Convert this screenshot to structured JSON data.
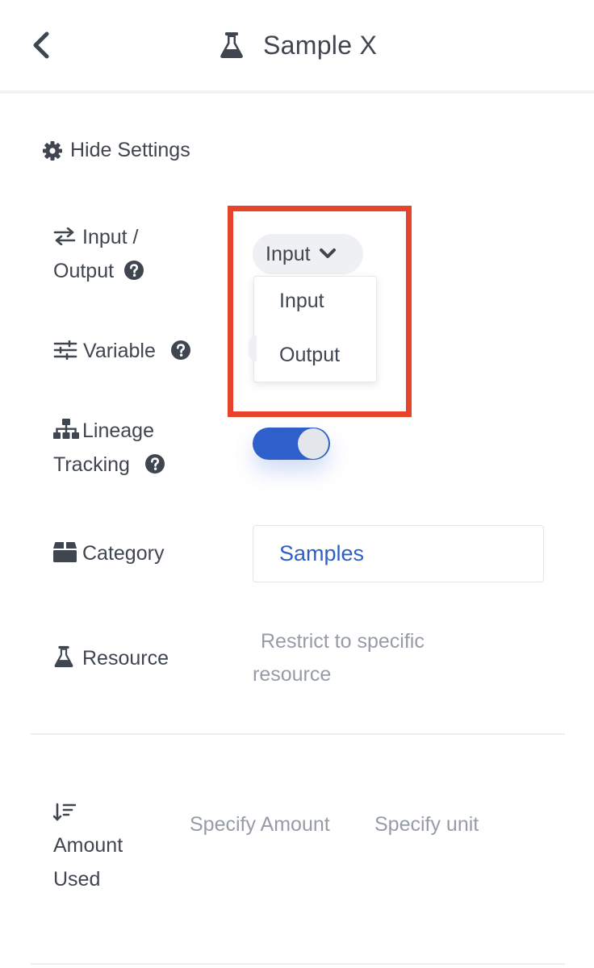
{
  "header": {
    "title": "Sample X",
    "back_icon": "chevron-left-icon",
    "title_icon": "flask-icon"
  },
  "settings_toggle": {
    "label": "Hide Settings",
    "icon": "gear-icon"
  },
  "fields": {
    "input_output": {
      "label_line1": "Input /",
      "label_line2": "Output",
      "icon": "arrows-exchange-icon",
      "selected": "Input",
      "options": [
        "Input",
        "Output"
      ]
    },
    "variable": {
      "label": "Variable",
      "icon": "sliders-icon"
    },
    "lineage_tracking": {
      "label_line1": "Lineage",
      "label_line2": "Tracking",
      "icon": "sitemap-icon",
      "enabled": true
    },
    "category": {
      "label": "Category",
      "icon": "box-icon",
      "value": "Samples"
    },
    "resource": {
      "label": "Resource",
      "icon": "flask-icon",
      "placeholder_line1": "Restrict to specific",
      "placeholder_line2": "resource"
    },
    "amount_used": {
      "label_line1": "Amount",
      "label_line2": "Used",
      "icon": "sort-amount-down-icon",
      "amount_placeholder": "Specify Amount",
      "unit_placeholder": "Specify unit"
    }
  },
  "colors": {
    "accent": "#2f5fcb",
    "highlight": "#e8432b",
    "text": "#3f4650",
    "muted": "#969ca6"
  }
}
